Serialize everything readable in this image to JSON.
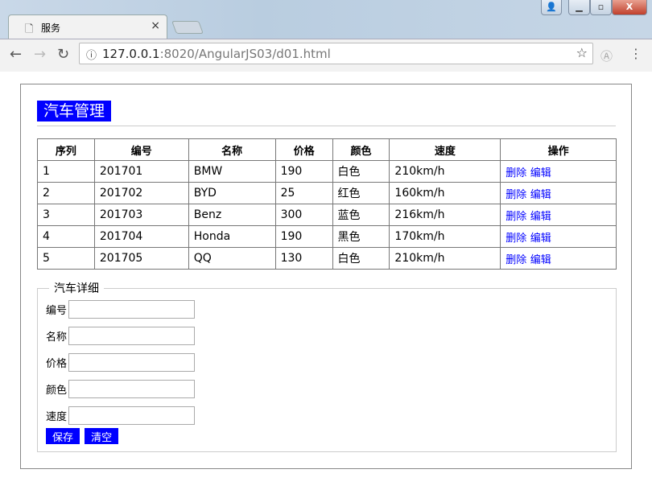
{
  "browser": {
    "tab_title": "服务",
    "url_host": "127.0.0.1",
    "url_rest": ":8020/AngularJS03/d01.html"
  },
  "page": {
    "title": "汽车管理",
    "table": {
      "headers": [
        "序列",
        "编号",
        "名称",
        "价格",
        "颜色",
        "速度",
        "操作"
      ],
      "rows": [
        [
          "1",
          "201701",
          "BMW",
          "190",
          "白色",
          "210km/h"
        ],
        [
          "2",
          "201702",
          "BYD",
          "25",
          "红色",
          "160km/h"
        ],
        [
          "3",
          "201703",
          "Benz",
          "300",
          "蓝色",
          "216km/h"
        ],
        [
          "4",
          "201704",
          "Honda",
          "190",
          "黑色",
          "170km/h"
        ],
        [
          "5",
          "201705",
          "QQ",
          "130",
          "白色",
          "210km/h"
        ]
      ],
      "delete_label": "删除",
      "edit_label": "编辑"
    },
    "detail": {
      "legend": "汽车详细",
      "fields": [
        {
          "label": "编号",
          "value": ""
        },
        {
          "label": "名称",
          "value": ""
        },
        {
          "label": "价格",
          "value": ""
        },
        {
          "label": "颜色",
          "value": ""
        },
        {
          "label": "速度",
          "value": ""
        }
      ],
      "save_label": "保存",
      "clear_label": "清空"
    }
  }
}
